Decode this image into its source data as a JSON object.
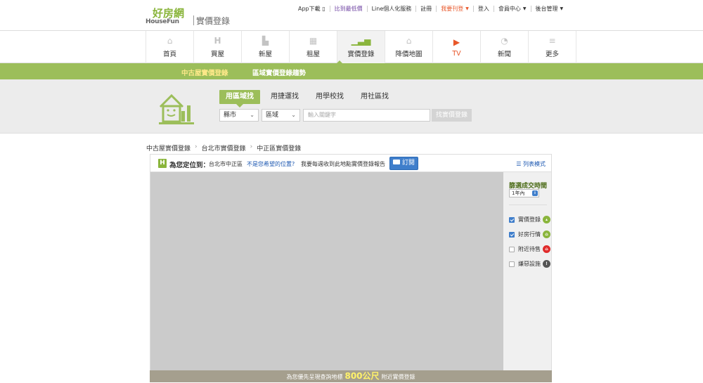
{
  "brand": {
    "logo_zh": "好房網",
    "logo_en": "HouseFun",
    "section": "實價登錄"
  },
  "top_links": [
    {
      "label": "App下載",
      "color": "normal",
      "icon": "phone-icon"
    },
    {
      "label": "比到最低價",
      "color": "purple"
    },
    {
      "label": "Line個人化服務",
      "color": "normal"
    },
    {
      "label": "註冊",
      "color": "normal"
    },
    {
      "label": "我要刊登",
      "color": "orange",
      "dropdown": true
    },
    {
      "label": "登入",
      "color": "normal"
    },
    {
      "label": "會員中心",
      "color": "normal",
      "dropdown": true
    },
    {
      "label": "後台管理",
      "color": "normal",
      "dropdown": true
    }
  ],
  "nav": [
    {
      "label": "首頁",
      "icon": "home-icon"
    },
    {
      "label": "買屋",
      "icon": "h-logo-icon"
    },
    {
      "label": "新屋",
      "icon": "buildings-icon"
    },
    {
      "label": "租屋",
      "icon": "apartment-icon"
    },
    {
      "label": "實價登錄",
      "icon": "bar-chart-icon",
      "active": true
    },
    {
      "label": "降價地圖",
      "icon": "house-outline-icon"
    },
    {
      "label": "TV",
      "icon": "play-icon"
    },
    {
      "label": "新聞",
      "icon": "rss-icon"
    },
    {
      "label": "更多",
      "icon": "menu-icon"
    }
  ],
  "subnav": {
    "items": [
      "中古屋實價登錄",
      "區域實價登錄趨勢"
    ],
    "active_index": 0
  },
  "search": {
    "tabs": [
      "用區域找",
      "用捷運找",
      "用學校找",
      "用社區找"
    ],
    "active_tab": 0,
    "city_select": "縣市",
    "district_select": "區域",
    "keyword_placeholder": "輸入關鍵字",
    "button": "找實價登錄"
  },
  "breadcrumb": [
    "中古屋實價登錄",
    "台北市實價登錄",
    "中正區實價登錄"
  ],
  "location_bar": {
    "lead": "為您定位到：",
    "place": "台北市中正區",
    "wrong_link": "不是您希望的位置?",
    "subscribe_prompt": "我要每週收到此地點實價登錄報告",
    "subscribe_button": "訂閱",
    "list_mode": "列表模式"
  },
  "filter_panel": {
    "title": "篩選成交時間",
    "period": "1年內",
    "options": [
      {
        "label": "實價登錄",
        "checked": true,
        "badge_color": "#8ab53c",
        "icon": "chart-badge-icon"
      },
      {
        "label": "好房行情",
        "checked": true,
        "badge_color": "#8ab53c",
        "icon": "house-badge-icon"
      },
      {
        "label": "附近待售",
        "checked": false,
        "badge_color": "#e02b2b",
        "icon": "sale-badge-icon"
      },
      {
        "label": "嫌惡設施",
        "checked": false,
        "badge_color": "#555555",
        "icon": "warning-badge-icon"
      }
    ]
  },
  "bottom_bar": {
    "prefix": "為您優先呈現查詢地標",
    "distance": "800公尺",
    "suffix": "附近實價登錄"
  },
  "colors": {
    "brand_green": "#8ab53c",
    "subnav_green": "#9cbe5a",
    "tv_orange": "#e8572a",
    "link_blue": "#1a56b0"
  }
}
